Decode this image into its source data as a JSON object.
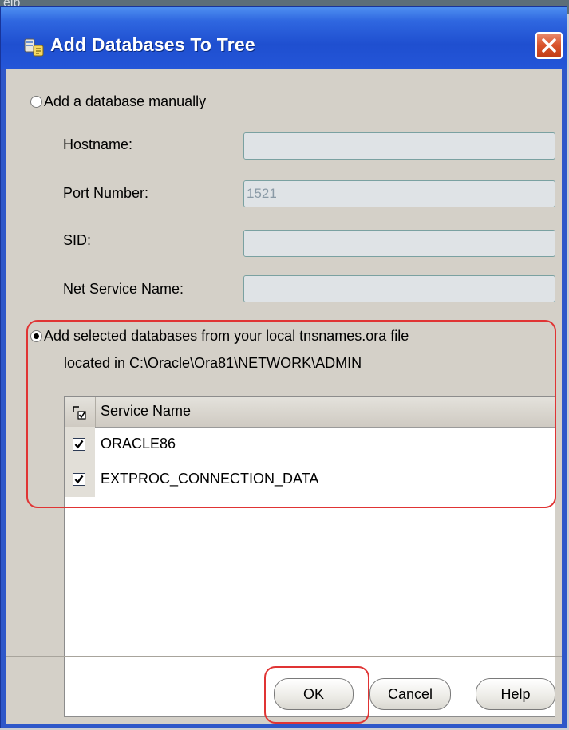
{
  "background_fragment": "eib",
  "dialog": {
    "title": "Add Databases To Tree",
    "option_manual": {
      "label": "Add a database manually",
      "selected": false
    },
    "fields": [
      {
        "label": "Hostname:",
        "value": "",
        "enabled": false
      },
      {
        "label": "Port Number:",
        "value": "1521",
        "enabled": false
      },
      {
        "label": "SID:",
        "value": "",
        "enabled": false
      },
      {
        "label": "Net Service Name:",
        "value": "",
        "enabled": false
      }
    ],
    "option_tnsnames": {
      "line1": "Add selected databases from your local tnsnames.ora file",
      "line2": "located in C:\\Oracle\\Ora81\\NETWORK\\ADMIN",
      "selected": true
    },
    "table": {
      "column_header": "Service Name",
      "rows": [
        {
          "name": "ORACLE86",
          "checked": true
        },
        {
          "name": "EXTPROC_CONNECTION_DATA",
          "checked": true
        }
      ]
    },
    "buttons": {
      "ok": "OK",
      "cancel": "Cancel",
      "help": "Help"
    }
  },
  "icons": {
    "app": "database-tree-icon",
    "close": "close-icon",
    "header_check": "select-all-checkbox-icon",
    "row_check": "checkbox-checked-icon"
  },
  "colors": {
    "titlebar": "#2456d8",
    "dialog_face": "#d4d0c8",
    "highlight": "#e03434",
    "close": "#d9532b"
  }
}
